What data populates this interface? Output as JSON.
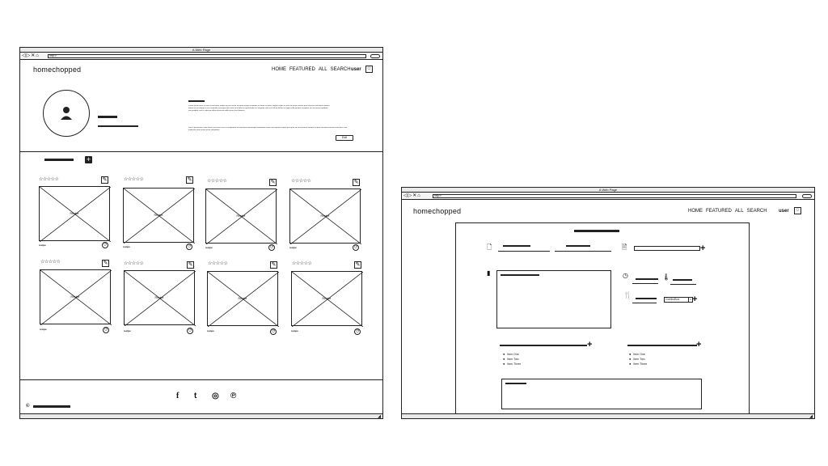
{
  "left_window": {
    "title": "A Web Page",
    "url": "http://",
    "brand": "homechopped",
    "nav": [
      "HOME",
      "FEATURED",
      "ALL",
      "SEARCH"
    ],
    "user_label": "user",
    "profile_button": "Edit",
    "bio_text": "Lorem ipsum dolor sit amet consectetur adipiscing elit sed do eiusmod tempor incididunt ut labore et dolore magna aliqua ut enim ad minim veniam quis nostrud exercitation ullamco laboris nisi ut aliquip ex ea commodo consequat duis aute irure dolor in reprehenderit in voluptate velit esse cillum dolore eu fugiat nulla pariatur excepteur sint occaecat cupidatat non proident sunt in culpa qui officia deserunt mollit anim id est laborum",
    "bio_text2": "Sed ut perspiciatis unde omnis iste natus error sit voluptatem accusantium doloremque laudantium totam rem aperiam eaque ipsa quae ab illo inventore veritatis et quasi architecto beatae vitae dicta sunt explicabo nemo enim ipsam voluptatem",
    "cards": [
      {
        "image_label": "Recipe",
        "caption": "recipe",
        "stars": "☆☆☆☆☆"
      },
      {
        "image_label": "Recipe",
        "caption": "recipe",
        "stars": "☆☆☆☆☆"
      },
      {
        "image_label": "Recipe",
        "caption": "recipe",
        "stars": "☆☆☆☆☆"
      },
      {
        "image_label": "Recipe",
        "caption": "recipe",
        "stars": "☆☆☆☆☆"
      },
      {
        "image_label": "Recipe",
        "caption": "recipe",
        "stars": "☆☆☆☆☆"
      },
      {
        "image_label": "Recipe",
        "caption": "recipe",
        "stars": "☆☆☆☆☆"
      },
      {
        "image_label": "Recipe",
        "caption": "recipe",
        "stars": "☆☆☆☆☆"
      },
      {
        "image_label": "Recipe",
        "caption": "recipe",
        "stars": "☆☆☆☆☆"
      }
    ],
    "social_icons": [
      "facebook-icon",
      "twitter-icon",
      "instagram-icon",
      "pinterest-icon"
    ],
    "social_glyphs": [
      "f",
      "t",
      "◎",
      "℗"
    ],
    "footer_copy": "©"
  },
  "right_window": {
    "title": "A Web Page",
    "url": "http://",
    "brand": "homechopped",
    "nav": [
      "HOME",
      "FEATURED",
      "ALL",
      "SEARCH"
    ],
    "user_label": "user",
    "combobox_value": "ComboBox",
    "list_a": [
      "Item One",
      "Item Two",
      "Item Three"
    ],
    "list_b": [
      "Item One",
      "Item Two",
      "Item Three"
    ]
  }
}
